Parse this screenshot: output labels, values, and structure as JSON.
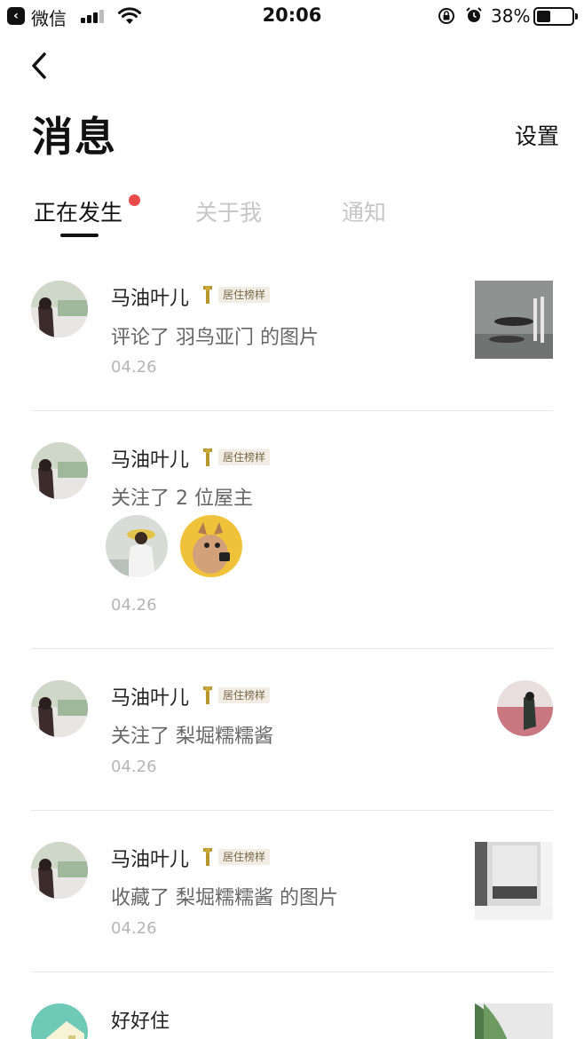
{
  "status_bar": {
    "back_app": "微信",
    "time": "20:06",
    "battery_pct": "38%"
  },
  "header": {
    "title": "消息",
    "settings_label": "设置"
  },
  "tabs": [
    {
      "label": "正在发生",
      "active": true,
      "has_dot": true
    },
    {
      "label": "关于我",
      "active": false
    },
    {
      "label": "通知",
      "active": false
    }
  ],
  "badge_label": "居住榜样",
  "feed": [
    {
      "user": "马油叶儿",
      "action": "评论了 羽鸟亚门 的图片",
      "date": "04.26",
      "has_badge": true
    },
    {
      "user": "马油叶儿",
      "action": "关注了 2 位屋主",
      "date": "04.26",
      "has_badge": true
    },
    {
      "user": "马油叶儿",
      "action": "关注了 梨堀糯糯酱",
      "date": "04.26",
      "has_badge": true
    },
    {
      "user": "马油叶儿",
      "action": "收藏了 梨堀糯糯酱 的图片",
      "date": "04.26",
      "has_badge": true
    },
    {
      "user": "好好住",
      "action": "",
      "date": "",
      "has_badge": false
    }
  ],
  "colors": {
    "accent_dot": "#e94b4b",
    "badge_bg": "#f1ede5",
    "badge_text": "#7a6a4b",
    "inactive_tab": "#c6c6c6"
  }
}
